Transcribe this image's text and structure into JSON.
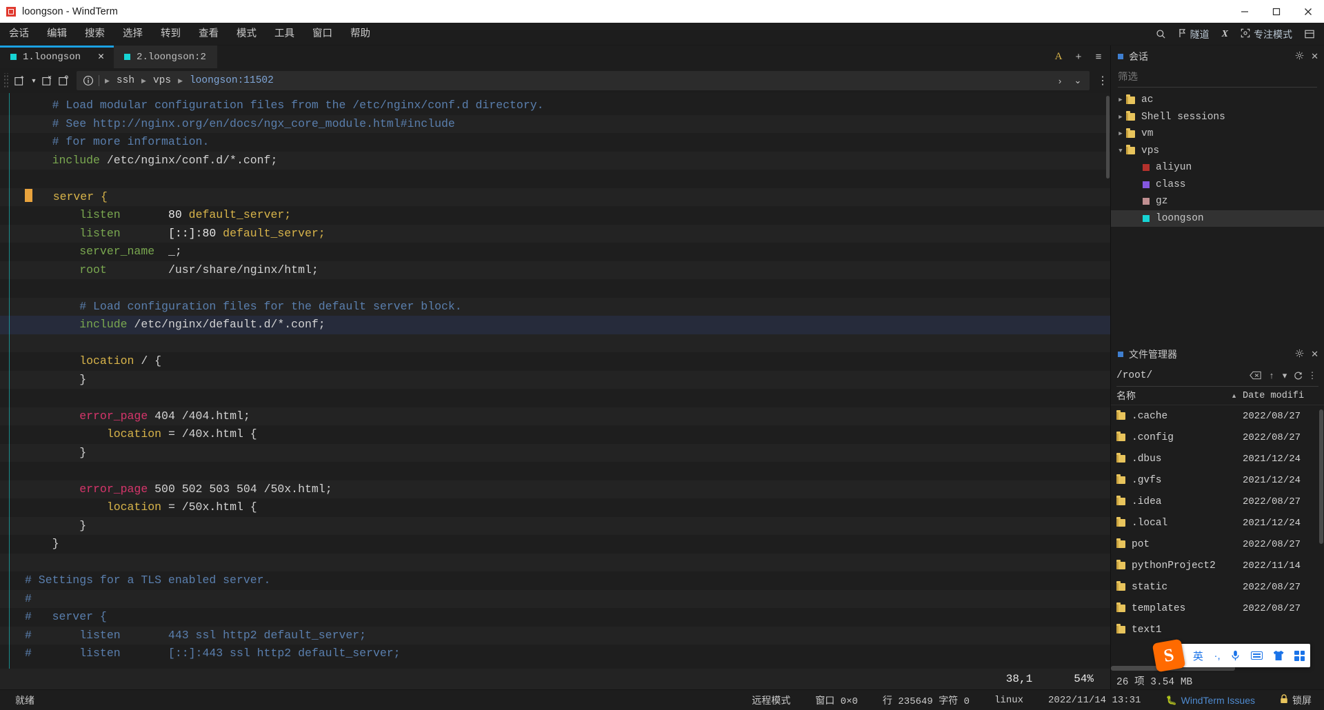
{
  "window": {
    "title": "loongson - WindTerm",
    "controls": {
      "minimize": "minimize-icon",
      "maximize": "maximize-icon",
      "close": "close-icon"
    }
  },
  "menubar": {
    "items": [
      "会话",
      "编辑",
      "搜索",
      "选择",
      "转到",
      "查看",
      "模式",
      "工具",
      "窗口",
      "帮助"
    ],
    "right": {
      "search_icon": "search-icon",
      "tunnel_label": "隧道",
      "x_label": "X",
      "focus_label": "专注模式",
      "layout_icon": "layout-icon"
    }
  },
  "tabs": [
    {
      "label": "1.loongson",
      "active": true,
      "closable": true
    },
    {
      "label": "2.loongson:2",
      "active": false,
      "closable": false
    }
  ],
  "tabbar_actions": {
    "font": "A",
    "add": "+",
    "menu": "≡",
    "collapse": "⌄",
    "more": "⋮"
  },
  "toolbar": {
    "new_session": "new-session-icon",
    "close_session": "close-session-icon",
    "clone_session": "clone-session-icon",
    "info": "info-icon",
    "breadcrumb": [
      "ssh",
      "vps",
      "loongson:11502"
    ],
    "send_icon": "›",
    "expand_icon": "⌄",
    "more_icon": "⋮"
  },
  "terminal": {
    "cursor_position": "38,1",
    "scroll_percent": "54%",
    "lines": [
      {
        "stripe": false,
        "indent": 4,
        "segs": [
          {
            "t": "# Load modular configuration files from the /etc/nginx/conf.d directory.",
            "c": "com"
          }
        ]
      },
      {
        "stripe": true,
        "indent": 4,
        "segs": [
          {
            "t": "# See http://nginx.org/en/docs/ngx_core_module.html#include",
            "c": "com"
          }
        ]
      },
      {
        "stripe": false,
        "indent": 4,
        "segs": [
          {
            "t": "# for more information.",
            "c": "com"
          }
        ]
      },
      {
        "stripe": true,
        "indent": 4,
        "segs": [
          {
            "t": "include",
            "c": "kw"
          },
          {
            "t": " /etc/nginx/conf.d/*.conf;",
            "c": "str"
          }
        ]
      },
      {
        "stripe": false,
        "indent": 0,
        "segs": []
      },
      {
        "stripe": true,
        "indent": 0,
        "cursor": true,
        "segs": [
          {
            "t": "   server {",
            "c": "gold"
          }
        ]
      },
      {
        "stripe": false,
        "indent": 8,
        "segs": [
          {
            "t": "listen",
            "c": "kw"
          },
          {
            "t": "       ",
            "c": "str"
          },
          {
            "t": "80",
            "c": "num"
          },
          {
            "t": " ",
            "c": "str"
          },
          {
            "t": "default_server",
            "c": "gold"
          },
          {
            "t": ";",
            "c": "gold"
          }
        ]
      },
      {
        "stripe": true,
        "indent": 8,
        "segs": [
          {
            "t": "listen",
            "c": "kw"
          },
          {
            "t": "       ",
            "c": "str"
          },
          {
            "t": "[::]:80",
            "c": "num"
          },
          {
            "t": " ",
            "c": "str"
          },
          {
            "t": "default_server",
            "c": "gold"
          },
          {
            "t": ";",
            "c": "gold"
          }
        ]
      },
      {
        "stripe": false,
        "indent": 8,
        "segs": [
          {
            "t": "server_name",
            "c": "kw"
          },
          {
            "t": "  _;",
            "c": "str"
          }
        ]
      },
      {
        "stripe": true,
        "indent": 8,
        "segs": [
          {
            "t": "root",
            "c": "kw"
          },
          {
            "t": "         /usr/share/nginx/html;",
            "c": "str"
          }
        ]
      },
      {
        "stripe": false,
        "indent": 0,
        "segs": []
      },
      {
        "stripe": true,
        "indent": 8,
        "segs": [
          {
            "t": "# Load configuration files for the default server block.",
            "c": "com"
          }
        ]
      },
      {
        "stripe": false,
        "hl": true,
        "indent": 8,
        "segs": [
          {
            "t": "include",
            "c": "kw"
          },
          {
            "t": " /etc/nginx/default.d/*.conf;",
            "c": "str"
          }
        ]
      },
      {
        "stripe": true,
        "indent": 0,
        "segs": []
      },
      {
        "stripe": false,
        "indent": 8,
        "segs": [
          {
            "t": "location",
            "c": "gold"
          },
          {
            "t": " / {",
            "c": "str"
          }
        ]
      },
      {
        "stripe": true,
        "indent": 8,
        "segs": [
          {
            "t": "}",
            "c": "str"
          }
        ]
      },
      {
        "stripe": false,
        "indent": 0,
        "segs": []
      },
      {
        "stripe": true,
        "indent": 8,
        "segs": [
          {
            "t": "error_page",
            "c": "pink"
          },
          {
            "t": " 404 /404.html;",
            "c": "str"
          }
        ]
      },
      {
        "stripe": false,
        "indent": 12,
        "segs": [
          {
            "t": "location",
            "c": "gold"
          },
          {
            "t": " = /40x.html {",
            "c": "str"
          }
        ]
      },
      {
        "stripe": true,
        "indent": 8,
        "segs": [
          {
            "t": "}",
            "c": "str"
          }
        ]
      },
      {
        "stripe": false,
        "indent": 0,
        "segs": []
      },
      {
        "stripe": true,
        "indent": 8,
        "segs": [
          {
            "t": "error_page",
            "c": "pink"
          },
          {
            "t": " 500 502 503 504 /50x.html;",
            "c": "str"
          }
        ]
      },
      {
        "stripe": false,
        "indent": 12,
        "segs": [
          {
            "t": "location",
            "c": "gold"
          },
          {
            "t": " = /50x.html {",
            "c": "str"
          }
        ]
      },
      {
        "stripe": true,
        "indent": 8,
        "segs": [
          {
            "t": "}",
            "c": "str"
          }
        ]
      },
      {
        "stripe": false,
        "indent": 4,
        "segs": [
          {
            "t": "}",
            "c": "str"
          }
        ]
      },
      {
        "stripe": true,
        "indent": 0,
        "segs": []
      },
      {
        "stripe": false,
        "indent": 0,
        "segs": [
          {
            "t": "# Settings for a TLS enabled server.",
            "c": "com"
          }
        ]
      },
      {
        "stripe": true,
        "indent": 0,
        "segs": [
          {
            "t": "#",
            "c": "com"
          }
        ]
      },
      {
        "stripe": false,
        "indent": 0,
        "segs": [
          {
            "t": "#   server {",
            "c": "com"
          }
        ]
      },
      {
        "stripe": true,
        "indent": 0,
        "segs": [
          {
            "t": "#       listen       443 ssl http2 default_server;",
            "c": "com"
          }
        ]
      },
      {
        "stripe": false,
        "indent": 0,
        "segs": [
          {
            "t": "#       listen       [::]:443 ssl http2 default_server;",
            "c": "com"
          }
        ]
      }
    ]
  },
  "sessions_panel": {
    "title": "会话",
    "filter_placeholder": "筛选",
    "settings_icon": "gear-icon",
    "close_icon": "close-icon",
    "tree": [
      {
        "label": "ac",
        "type": "folder",
        "expanded": false,
        "depth": 0
      },
      {
        "label": "Shell sessions",
        "type": "folder",
        "expanded": false,
        "depth": 0
      },
      {
        "label": "vm",
        "type": "folder",
        "expanded": false,
        "depth": 0
      },
      {
        "label": "vps",
        "type": "folder",
        "expanded": true,
        "depth": 0
      },
      {
        "label": "aliyun",
        "type": "session",
        "color": "#b4312c",
        "depth": 1
      },
      {
        "label": "class",
        "type": "session",
        "color": "#8457e0",
        "depth": 1
      },
      {
        "label": "gz",
        "type": "session",
        "color": "#c08f91",
        "depth": 1
      },
      {
        "label": "loongson",
        "type": "session",
        "color": "#16d4d4",
        "depth": 1,
        "selected": true
      }
    ]
  },
  "file_panel": {
    "title": "文件管理器",
    "settings_icon": "gear-icon",
    "close_icon": "close-icon",
    "path": "/root/",
    "clear_icon": "backspace-icon",
    "up_icon": "↑",
    "dropdown_icon": "▾",
    "refresh_icon": "refresh-icon",
    "more_icon": "⋮",
    "columns": {
      "name": "名称",
      "date": "Date modifi"
    },
    "sort_arrow": "▲",
    "files": [
      {
        "name": ".cache",
        "date": "2022/08/27"
      },
      {
        "name": ".config",
        "date": "2022/08/27"
      },
      {
        "name": ".dbus",
        "date": "2021/12/24"
      },
      {
        "name": ".gvfs",
        "date": "2021/12/24"
      },
      {
        "name": ".idea",
        "date": "2022/08/27"
      },
      {
        "name": ".local",
        "date": "2021/12/24"
      },
      {
        "name": "pot",
        "date": "2022/08/27"
      },
      {
        "name": "pythonProject2",
        "date": "2022/11/14"
      },
      {
        "name": "static",
        "date": "2022/08/27"
      },
      {
        "name": "templates",
        "date": "2022/08/27"
      },
      {
        "name": "text1",
        "date": ""
      }
    ],
    "footer": "26 项 3.54 MB"
  },
  "statusbar": {
    "left": "就绪",
    "mode": "远程模式",
    "window_size": "窗口 0×0",
    "line_chars": "行 235649 字符 0",
    "os": "linux",
    "datetime": "2022/11/14 13:31",
    "issues_label": "WindTerm Issues",
    "lock_label": "锁屏"
  },
  "ime": {
    "logo": "S",
    "mode_label": "英",
    "punctuation": "·,",
    "mic_icon": "mic-icon",
    "keyboard_icon": "keyboard-icon",
    "skin_icon": "skin-icon",
    "apps_icon": "apps-icon"
  },
  "colors": {
    "accent": "#1ba1e2",
    "session_active": "#16d4d4",
    "comment": "#5a7fae",
    "keyword": "#7aa850",
    "gold": "#d8b44a",
    "pink": "#d6356b",
    "link": "#4f8bd0"
  }
}
